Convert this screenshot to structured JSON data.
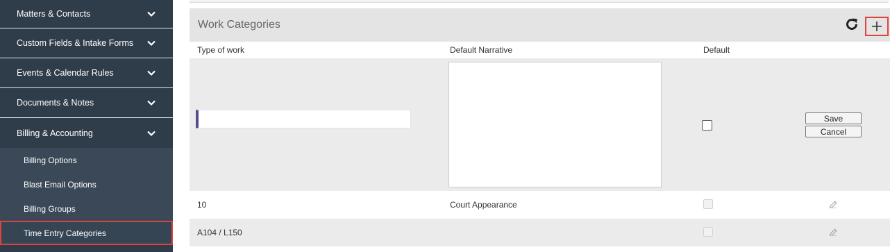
{
  "sidebar": {
    "sections": [
      {
        "label": "Matters & Contacts"
      },
      {
        "label": "Custom Fields & Intake Forms"
      },
      {
        "label": "Events & Calendar Rules"
      },
      {
        "label": "Documents & Notes"
      },
      {
        "label": "Billing & Accounting"
      }
    ],
    "sub_items": [
      {
        "label": "Billing Options"
      },
      {
        "label": "Blast Email Options"
      },
      {
        "label": "Billing Groups"
      },
      {
        "label": "Time Entry Categories"
      }
    ]
  },
  "panel": {
    "title": "Work Categories",
    "columns": {
      "type": "Type of work",
      "narrative": "Default Narrative",
      "default": "Default"
    },
    "edit_row": {
      "type_value": "",
      "narrative_value": "",
      "save_label": "Save",
      "cancel_label": "Cancel"
    },
    "rows": [
      {
        "type": "10",
        "narrative": "Court Appearance",
        "default": false
      },
      {
        "type": "A104 / L150",
        "narrative": "",
        "default": false
      }
    ]
  },
  "colors": {
    "sidebar_bg": "#2f3c4a",
    "highlight": "#e0433d",
    "accent": "#5b4a8b"
  },
  "icons": {
    "refresh": "refresh-icon",
    "add": "plus-icon",
    "edit": "pencil-icon",
    "chevron": "chevron-down-icon"
  }
}
